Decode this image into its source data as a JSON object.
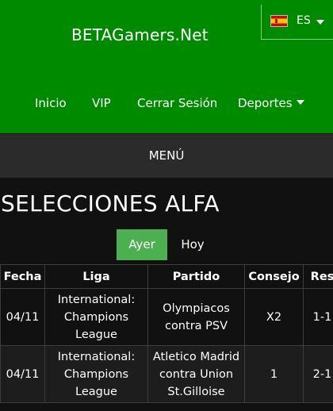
{
  "header": {
    "brand": "BETAGamers.Net",
    "language": {
      "code": "ES",
      "flag_icon": "spain-flag-icon"
    },
    "nav": [
      {
        "label": "Inicio"
      },
      {
        "label": "VIP"
      },
      {
        "label": "Cerrar Sesión"
      },
      {
        "label": "Deportes"
      }
    ]
  },
  "menu": {
    "label": "MENÚ"
  },
  "section": {
    "title": "SELECCIONES ALFA"
  },
  "tabs": [
    {
      "label": "Ayer",
      "active": true
    },
    {
      "label": "Hoy",
      "active": false
    }
  ],
  "table": {
    "headers": [
      "Fecha",
      "Liga",
      "Partido",
      "Consejo",
      "Res"
    ],
    "rows": [
      {
        "fecha": "04/11",
        "liga": "International: Champions League",
        "partido": "Olympiacos contra PSV",
        "consejo": "X2",
        "res": "1-1"
      },
      {
        "fecha": "04/11",
        "liga": "International: Champions League",
        "partido": "Atletico Madrid contra Union St.Gilloise",
        "consejo": "1",
        "res": "2-1"
      }
    ]
  },
  "colors": {
    "header_green": "#008a00",
    "tab_active_green": "#4caf50",
    "menu_bar": "#2b2b2b",
    "page_background": "#111111"
  }
}
